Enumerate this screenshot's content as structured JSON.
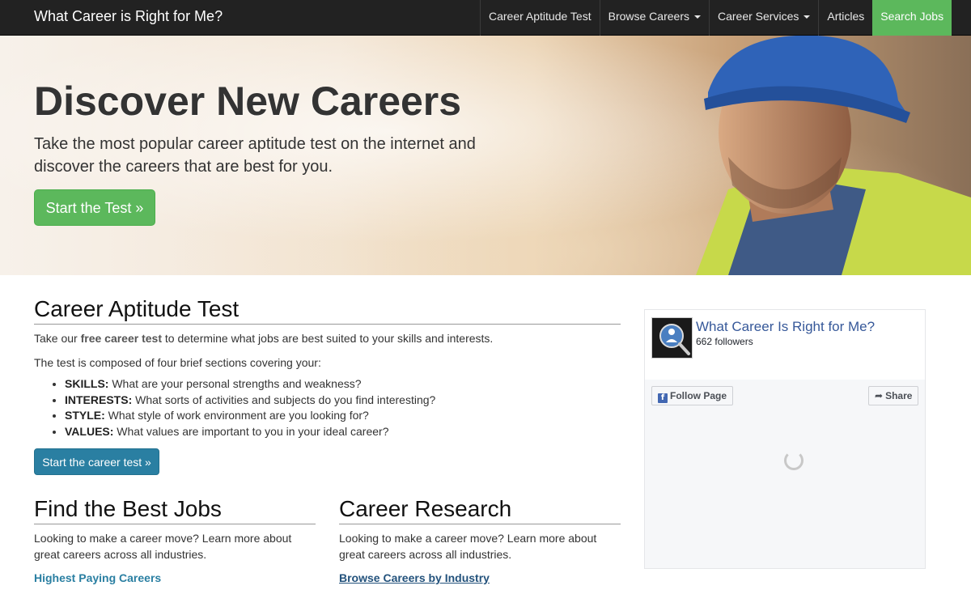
{
  "navbar": {
    "brand": "What Career is Right for Me?",
    "items": [
      {
        "label": "Career Aptitude Test"
      },
      {
        "label": "Browse Careers"
      },
      {
        "label": "Career Services"
      },
      {
        "label": "Articles"
      },
      {
        "label": "Search Jobs"
      }
    ]
  },
  "hero": {
    "title": "Discover New Careers",
    "subtitle": "Take the most popular career aptitude test on the internet and discover the careers that are best for you.",
    "button": "Start the Test »"
  },
  "aptitude": {
    "heading": "Career Aptitude Test",
    "intro_pre": "Take our ",
    "intro_bold": "free career test",
    "intro_post": " to determine what jobs are best suited to your skills and interests.",
    "composed": "The test is composed of four brief sections covering your:",
    "features": [
      {
        "term": "SKILLS:",
        "desc": " What are your personal strengths and weakness?"
      },
      {
        "term": "INTERESTS:",
        "desc": " What sorts of activities and subjects do you find interesting?"
      },
      {
        "term": "STYLE:",
        "desc": " What style of work environment are you looking for?"
      },
      {
        "term": "VALUES:",
        "desc": " What values are important to you in your ideal career?"
      }
    ],
    "button": "Start the career test »"
  },
  "best_jobs": {
    "heading": "Find the Best Jobs",
    "text": "Looking to make a career move? Learn more about great careers across all industries.",
    "link": "Highest Paying Careers"
  },
  "research": {
    "heading": "Career Research",
    "text": "Looking to make a career move? Learn more about great careers across all industries.",
    "link": "Browse Careers by Industry"
  },
  "facebook": {
    "page_name": "What Career Is Right for Me?",
    "followers": "662 followers",
    "follow": "Follow Page",
    "share": "Share"
  }
}
